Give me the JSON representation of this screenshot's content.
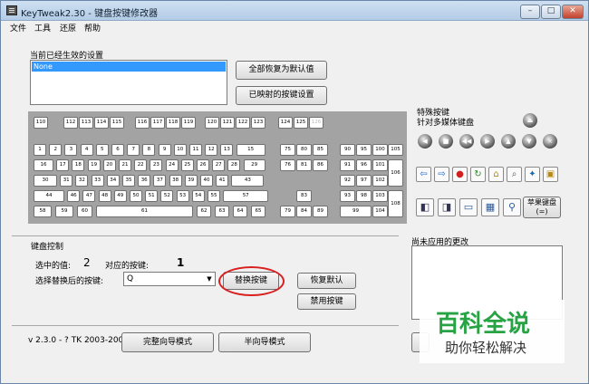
{
  "window": {
    "title": "KeyTweak2.30 -  键盘按键修改器",
    "min_label": "–",
    "max_label": "□",
    "close_label": "✕"
  },
  "menu": [
    "文件",
    "工具",
    "还原",
    "帮助"
  ],
  "current": {
    "label": "当前已经生效的设置",
    "list_selected": "None",
    "restore_all_label": "全部恢复为默认值",
    "mapped_label": "已映射的按键设置"
  },
  "keys": {
    "fn_row": [
      "110",
      "112",
      "113",
      "114",
      "115",
      "116",
      "117",
      "118",
      "119",
      "120",
      "121",
      "122",
      "123",
      "124",
      "125",
      "126"
    ],
    "row1": [
      "1",
      "2",
      "3",
      "4",
      "5",
      "6",
      "7",
      "8",
      "9",
      "10",
      "11",
      "12",
      "13",
      "15"
    ],
    "row2": [
      "16",
      "17",
      "18",
      "19",
      "20",
      "21",
      "22",
      "23",
      "24",
      "25",
      "26",
      "27",
      "28",
      "29"
    ],
    "row3": [
      "30",
      "31",
      "32",
      "33",
      "34",
      "35",
      "36",
      "37",
      "38",
      "39",
      "40",
      "41",
      "43"
    ],
    "row4": [
      "44",
      "46",
      "47",
      "48",
      "49",
      "50",
      "51",
      "52",
      "53",
      "54",
      "55",
      "57"
    ],
    "row5": [
      "58",
      "59",
      "60",
      "61",
      "62",
      "63",
      "64",
      "65"
    ],
    "nav": [
      "75",
      "80",
      "85",
      "76",
      "81",
      "86",
      "83",
      "79",
      "84",
      "89"
    ],
    "numpad": [
      "90",
      "95",
      "100",
      "105",
      "91",
      "96",
      "101",
      "106",
      "92",
      "97",
      "102",
      "93",
      "98",
      "103",
      "108",
      "99",
      "104"
    ]
  },
  "special": {
    "title": "特殊按键",
    "subtitle": "针对多媒体键盘",
    "apple_label": "苹果键盘\n(=)"
  },
  "control": {
    "title": "键盘控制",
    "selected_label": "选中的值:",
    "selected_value": "2",
    "mapped_label": "对应的按键:",
    "mapped_value": "1",
    "replace_label": "选择替换后的按键:",
    "combo_value": "Q",
    "replace_btn": "替换按键",
    "restore_btn": "恢复默认",
    "disable_btn": "禁用按键"
  },
  "pending": {
    "title": "尚未应用的更改"
  },
  "footer": {
    "version": "v 2.3.0 - ? TK 2003-2009",
    "full_mode": "完整向导模式",
    "half_mode": "半向导模式"
  },
  "watermark": {
    "line1": "百科全说",
    "line2": "助你轻松解决"
  }
}
